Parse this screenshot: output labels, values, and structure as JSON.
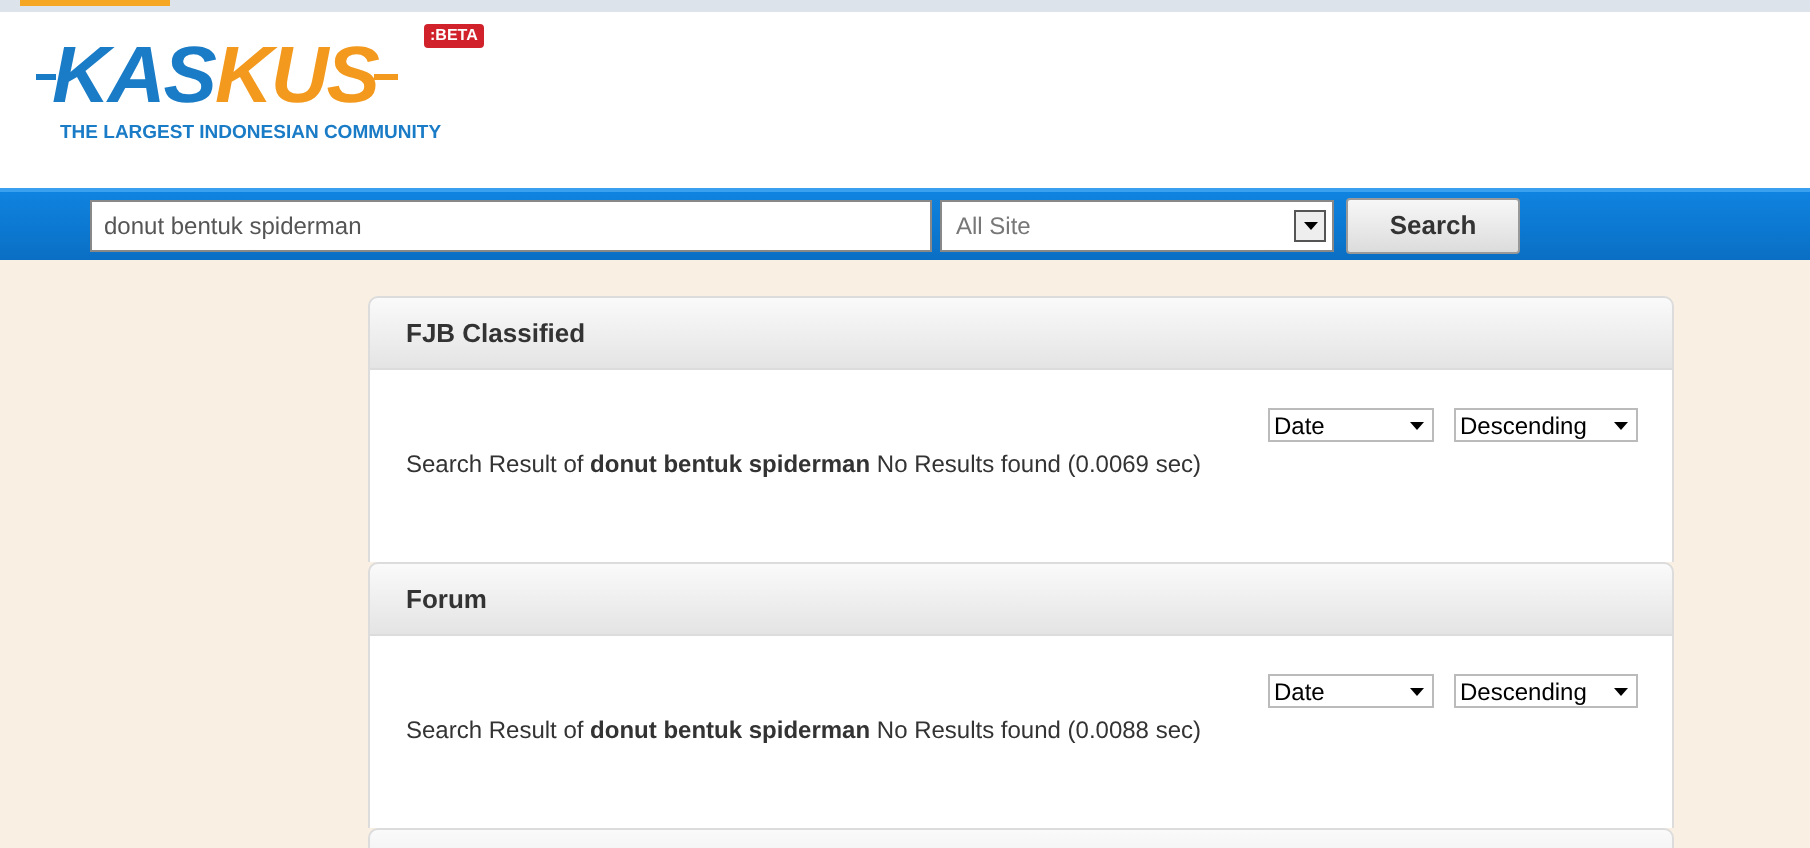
{
  "logo": {
    "parts": [
      "KAS",
      "KUS"
    ],
    "badge": ":BETA",
    "tagline": "THE LARGEST INDONESIAN COMMUNITY"
  },
  "search": {
    "value": "donut bentuk spiderman",
    "scope": "All Site",
    "button": "Search"
  },
  "sections": [
    {
      "title": "FJB Classified",
      "result": "Search Result of **donut bentuk spiderman** No Results found (0.0069 sec)",
      "sort_field": "Date",
      "sort_order": "Descending"
    },
    {
      "title": "Forum",
      "result": "Search Result of **donut bentuk spiderman** No Results found (0.0088 sec)",
      "sort_field": "Date",
      "sort_order": "Descending"
    }
  ]
}
